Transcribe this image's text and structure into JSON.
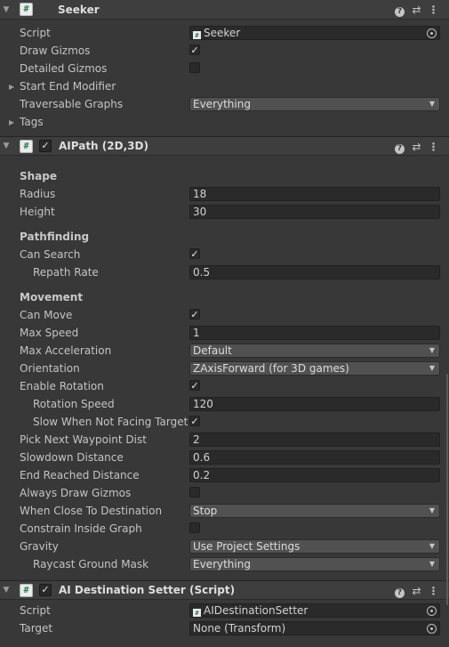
{
  "seeker": {
    "title": "Seeker",
    "script_label": "Script",
    "script_value": "Seeker",
    "draw_gizmos_label": "Draw Gizmos",
    "draw_gizmos": true,
    "detailed_gizmos_label": "Detailed Gizmos",
    "detailed_gizmos": false,
    "start_end_modifier_label": "Start End Modifier",
    "traversable_graphs_label": "Traversable Graphs",
    "traversable_graphs_value": "Everything",
    "tags_label": "Tags"
  },
  "aipath": {
    "title": "AIPath (2D,3D)",
    "enabled": true,
    "shape_title": "Shape",
    "radius_label": "Radius",
    "radius_value": "18",
    "height_label": "Height",
    "height_value": "30",
    "pathfinding_title": "Pathfinding",
    "can_search_label": "Can Search",
    "can_search": true,
    "repath_rate_label": "Repath Rate",
    "repath_rate_value": "0.5",
    "movement_title": "Movement",
    "can_move_label": "Can Move",
    "can_move": true,
    "max_speed_label": "Max Speed",
    "max_speed_value": "1",
    "max_acceleration_label": "Max Acceleration",
    "max_acceleration_value": "Default",
    "orientation_label": "Orientation",
    "orientation_value": "ZAxisForward (for 3D games)",
    "enable_rotation_label": "Enable Rotation",
    "enable_rotation": true,
    "rotation_speed_label": "Rotation Speed",
    "rotation_speed_value": "120",
    "slow_not_facing_label": "Slow When Not Facing Target",
    "slow_not_facing": true,
    "pick_next_label": "Pick Next Waypoint Dist",
    "pick_next_value": "2",
    "slowdown_label": "Slowdown Distance",
    "slowdown_value": "0.6",
    "end_reached_label": "End Reached Distance",
    "end_reached_value": "0.2",
    "always_draw_label": "Always Draw Gizmos",
    "always_draw": false,
    "when_close_label": "When Close To Destination",
    "when_close_value": "Stop",
    "constrain_label": "Constrain Inside Graph",
    "constrain": false,
    "gravity_label": "Gravity",
    "gravity_value": "Use Project Settings",
    "raycast_label": "Raycast Ground Mask",
    "raycast_value": "Everything"
  },
  "destination": {
    "title": "AI Destination Setter (Script)",
    "enabled": true,
    "script_label": "Script",
    "script_value": "AIDestinationSetter",
    "target_label": "Target",
    "target_value": "None (Transform)"
  },
  "icons": {
    "component": "csharp-script-icon",
    "help": "help-icon",
    "presets": "presets-sliders-icon",
    "menu": "kebab-menu-icon",
    "check": "✓"
  },
  "colors": {
    "background": "#383838",
    "header": "#3e3e3e",
    "field": "#2a2a2a",
    "dropdown": "#515151",
    "text": "#c4c4c4"
  }
}
